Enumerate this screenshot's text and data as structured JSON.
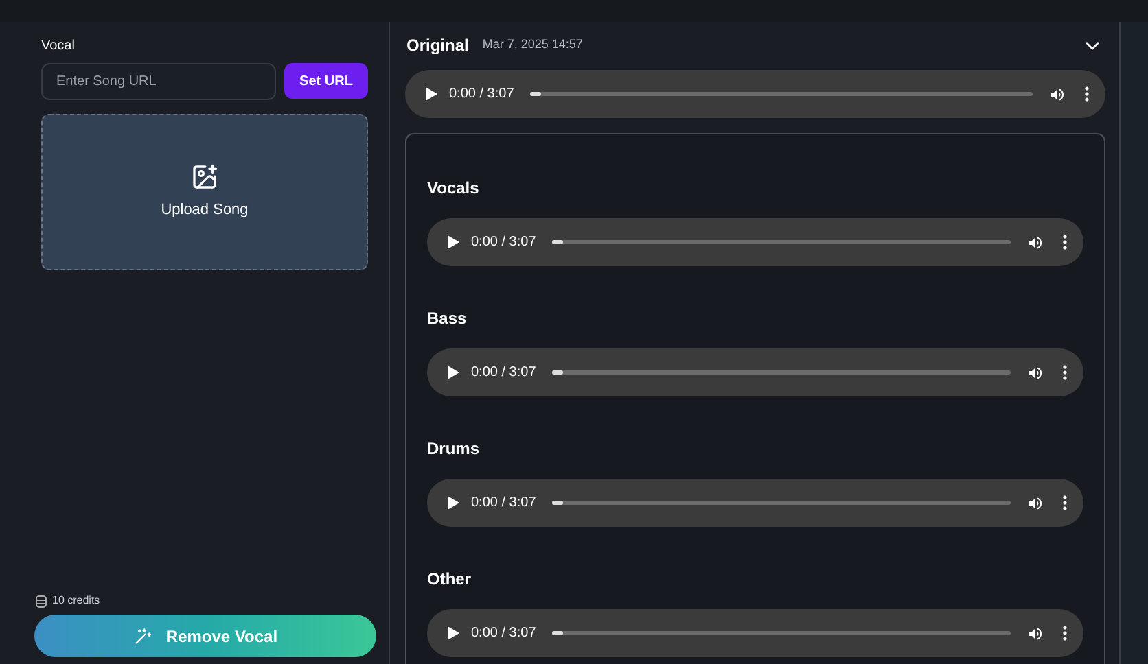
{
  "left": {
    "label": "Vocal",
    "url_field": {
      "placeholder": "Enter Song URL"
    },
    "set_url_button": "Set URL",
    "upload": {
      "label": "Upload Song"
    },
    "credits": "10 credits",
    "action_button": "Remove Vocal"
  },
  "original": {
    "title": "Original",
    "date": "Mar 7, 2025 14:57",
    "expanded": true,
    "player": {
      "time": "0:00 / 3:07",
      "level": 0
    }
  },
  "stems": [
    {
      "name": "Vocals",
      "player": {
        "time": "0:00 / 3:07",
        "level": 0
      }
    },
    {
      "name": "Bass",
      "player": {
        "time": "0:00 / 3:07",
        "level": 0
      }
    },
    {
      "name": "Drums",
      "player": {
        "time": "0:00 / 3:07",
        "level": 0
      }
    },
    {
      "name": "Other",
      "player": {
        "time": "0:00 / 3:07",
        "level": 0
      }
    }
  ]
}
